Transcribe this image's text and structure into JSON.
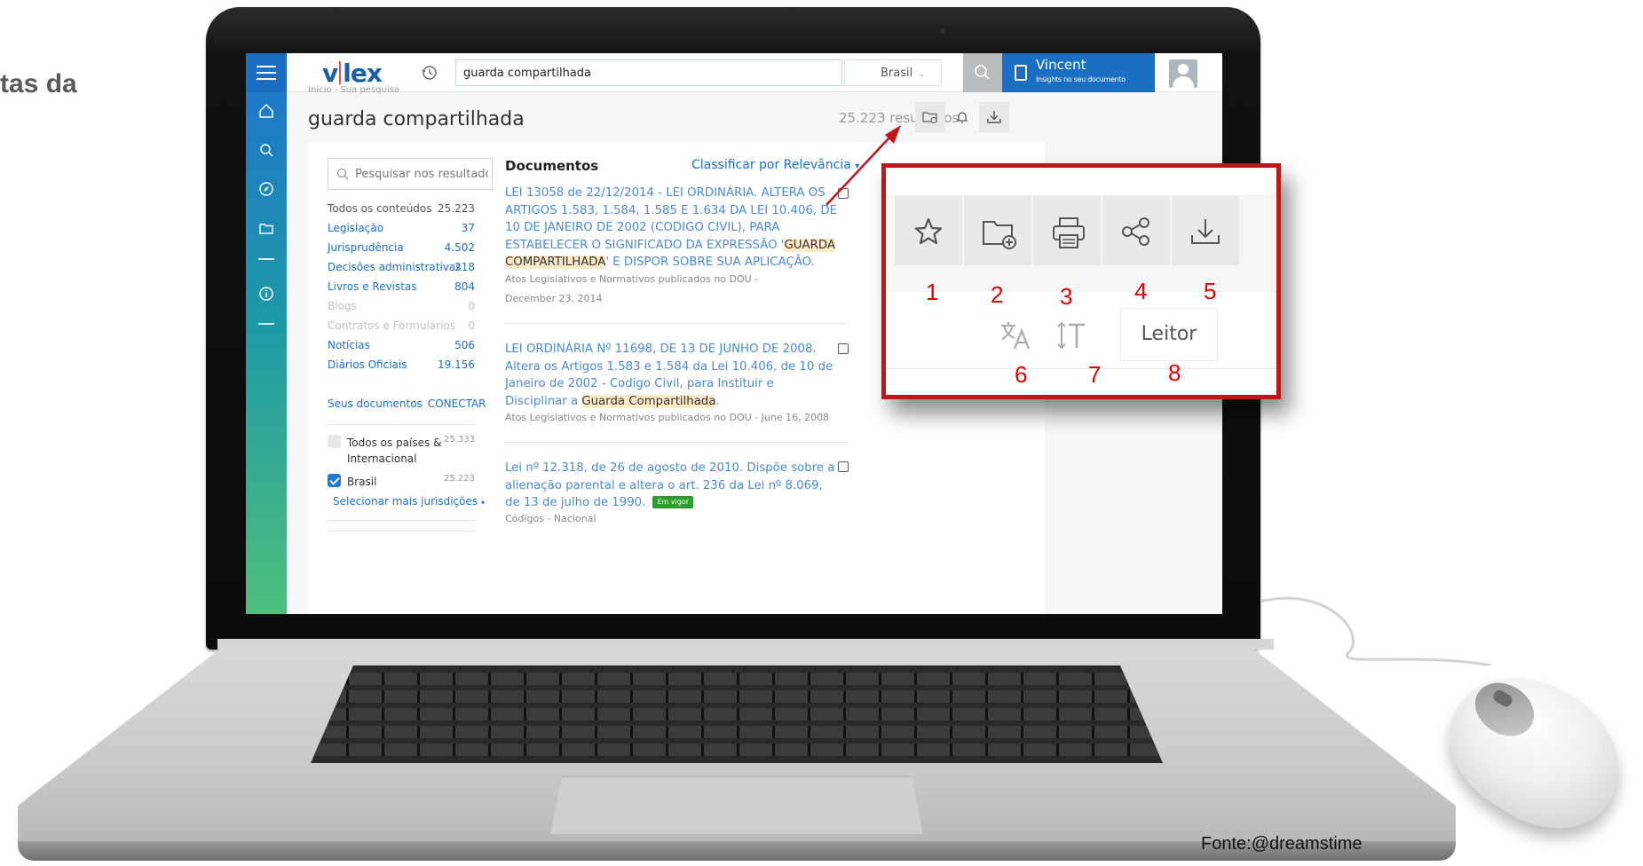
{
  "slide": {
    "title_fragment": "tas da",
    "credit": "Fonte:@dreamstime"
  },
  "topbar": {
    "logo": {
      "left": "v",
      "right": "lex"
    },
    "search_value": "guarda compartilhada",
    "country": "Brasil",
    "user_name": "Vincent",
    "user_subtitle": "Insights no seu documento"
  },
  "page": {
    "breadcrumb": "Início - Sua pesquisa",
    "title": "guarda compartilhada",
    "results": "25.223 resultados"
  },
  "filters": {
    "search_placeholder": "Pesquisar nos resultados",
    "items": [
      {
        "label": "Todos os conteúdos",
        "count": "25.223",
        "state": "plain"
      },
      {
        "label": "Legislação",
        "count": "37",
        "state": "link"
      },
      {
        "label": "Jurisprudência",
        "count": "4.502",
        "state": "link"
      },
      {
        "label": "Decisões administrativas",
        "count": "218",
        "state": "link"
      },
      {
        "label": "Livros e Revistas",
        "count": "804",
        "state": "link"
      },
      {
        "label": "Blogs",
        "count": "0",
        "state": "dim"
      },
      {
        "label": "Contratos e Formulários",
        "count": "0",
        "state": "dim"
      },
      {
        "label": "Notícias",
        "count": "506",
        "state": "link"
      },
      {
        "label": "Diários Oficiais",
        "count": "19.156",
        "state": "link"
      }
    ],
    "seus_documentos": "Seus documentos",
    "conectar": "CONECTAR",
    "countries": [
      {
        "label_line1": "Todos os países &",
        "label_line2": "Internacional",
        "count": "25.333",
        "checked": false
      },
      {
        "label_line1": "Brasil",
        "label_line2": "",
        "count": "25.223",
        "checked": true
      }
    ],
    "select_more": "Selecionar mais jurisdições"
  },
  "documents": {
    "heading": "Documentos",
    "sort": "Classificar por Relevância",
    "items": [
      {
        "title_before": "LEI 13058 de 22/12/2014  - LEI ORDINÁRIA. ALTERA OS ARTIGOS 1.583, 1.584, 1.585 E 1.634 DA LEI 10.406, DE 10 DE JANEIRO DE 2002 (CODIGO CIVIL), PARA ESTABELECER O SIGNIFICADO DA EXPRESSÃO '",
        "title_highlight": "GUARDA COMPARTILHADA",
        "title_after": "' E DISPOR SOBRE SUA APLICAÇÃO.",
        "meta_line1": "Atos Legislativos e Normativos publicados no DOU -",
        "meta_line2": "December 23, 2014",
        "badge": ""
      },
      {
        "title_before": "LEI ORDINÁRIA Nº 11698, DE 13 DE JUNHO DE 2008. Altera os Artigos 1.583 e 1.584 da Lei 10.406, de 10 de Janeiro de 2002 - Codigo Civil, para Instituir e Disciplinar a ",
        "title_highlight": "Guarda Compartilhada",
        "title_after": ".",
        "meta_line1": "Atos Legislativos e Normativos publicados no DOU - June 16, 2008",
        "meta_line2": "",
        "badge": ""
      },
      {
        "title_before": "Lei nº 12.318, de 26 de agosto de 2010. Dispõe sobre a alienação parental e altera o art. 236 da Lei nº 8.069, de 13 de julho de 1990.",
        "title_highlight": "",
        "title_after": "",
        "meta_line1": "Códigos - Nacional",
        "meta_line2": "",
        "badge": "Em vigor"
      }
    ]
  },
  "callout": {
    "buttons": [
      {
        "icon": "star-icon",
        "number": "1"
      },
      {
        "icon": "folder-add-icon",
        "number": "2"
      },
      {
        "icon": "print-icon",
        "number": "3"
      },
      {
        "icon": "share-icon",
        "number": "4"
      },
      {
        "icon": "download-icon",
        "number": "5"
      }
    ],
    "lower": [
      {
        "icon": "translate-icon",
        "number": "6"
      },
      {
        "icon": "text-size-icon",
        "number": "7"
      },
      {
        "label": "Leitor",
        "number": "8"
      }
    ]
  },
  "colors": {
    "accent": "#1b6fc2",
    "link": "#1c6fd1",
    "callout_border": "#c0161b",
    "callout_numbers": "#e60000",
    "highlight": "#fde9c6"
  }
}
